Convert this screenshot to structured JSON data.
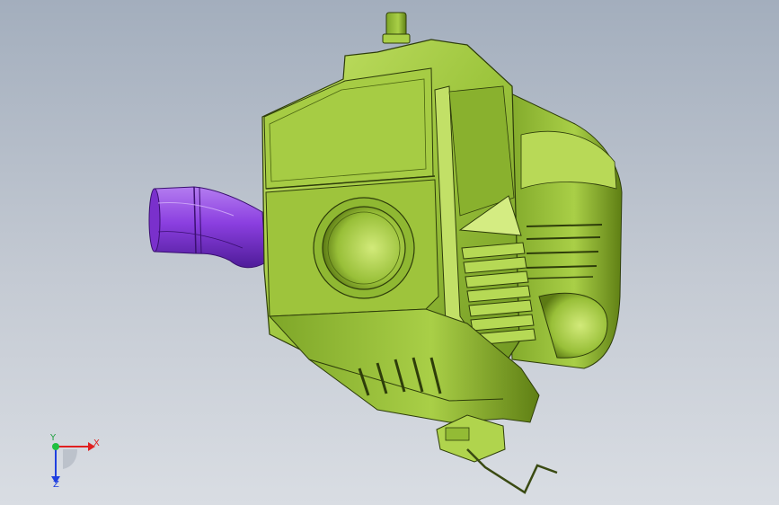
{
  "viewport": {
    "model_name": "air-filter-housing",
    "colors": {
      "body": "#9dc53d",
      "body_light": "#c7e46a",
      "body_dark": "#5f7f14",
      "edge": "#2e3d0a",
      "hose": "#8b3fe0",
      "hose_light": "#b47cf0",
      "hose_dark": "#4f1c99",
      "background_top": "#a3aebd",
      "background_bottom": "#d9dde3"
    }
  },
  "triad": {
    "x_label": "X",
    "y_label": "Y",
    "z_label": "Z",
    "colors": {
      "x": "#e02020",
      "y": "#20c040",
      "z": "#2040e0"
    }
  }
}
